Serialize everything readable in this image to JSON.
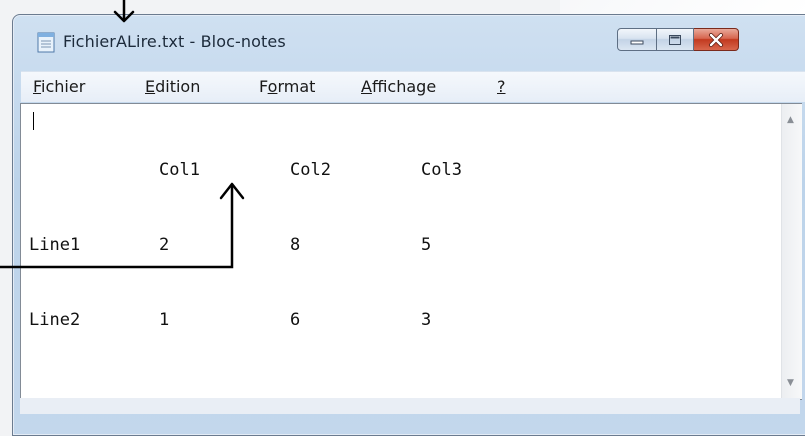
{
  "window": {
    "title": "FichierALire.txt - Bloc-notes",
    "app_icon": "notepad-icon"
  },
  "caption_buttons": {
    "minimize_icon": "minimize-icon",
    "maximize_icon": "maximize-icon",
    "close_icon": "close-icon"
  },
  "menu": {
    "items": [
      {
        "prefix": "",
        "mnemonic": "F",
        "rest": "ichier"
      },
      {
        "prefix": "",
        "mnemonic": "E",
        "rest": "dition"
      },
      {
        "prefix": "F",
        "mnemonic": "o",
        "rest": "rmat"
      },
      {
        "prefix": "",
        "mnemonic": "A",
        "rest": "ffichage"
      },
      {
        "prefix": "",
        "mnemonic": "?",
        "rest": ""
      }
    ]
  },
  "editor": {
    "header": [
      "",
      "Col1",
      "Col2",
      "Col3"
    ],
    "rows": [
      [
        "Line1",
        "2",
        "8",
        "5"
      ],
      [
        "Line2",
        "1",
        "6",
        "3"
      ]
    ]
  },
  "annotations": {
    "arrow_color": "#000000"
  }
}
